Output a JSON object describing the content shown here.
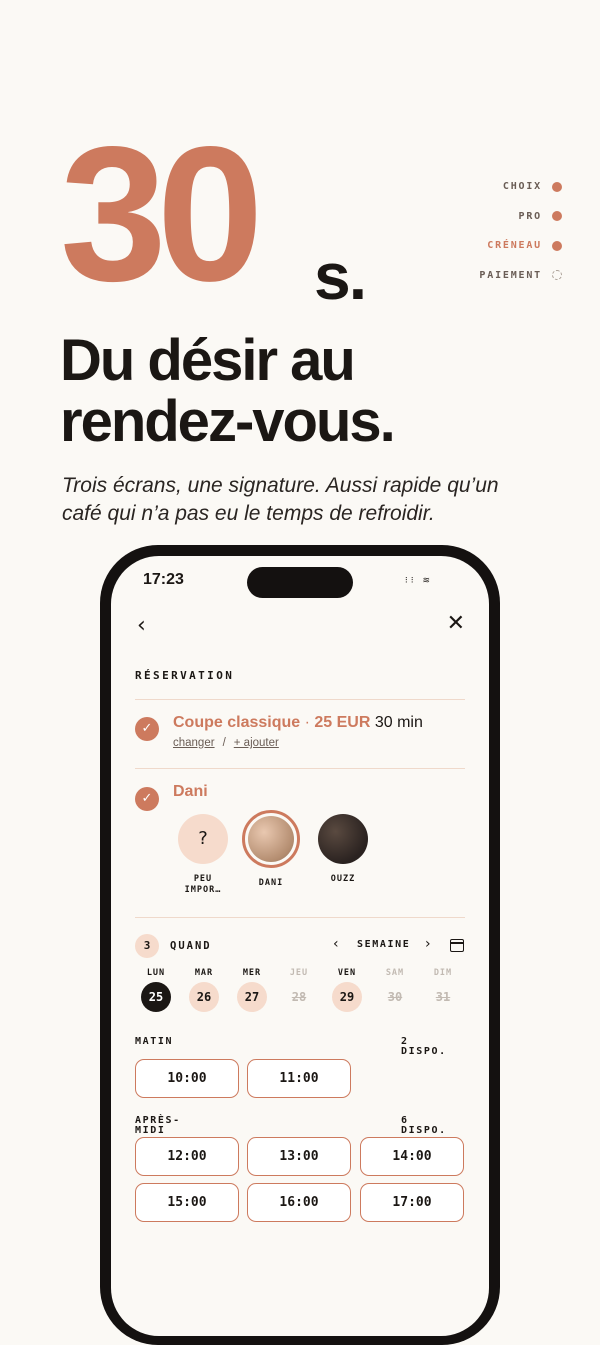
{
  "hero": {
    "number": "30",
    "unit": "s.",
    "headline_line1": "Du désir au",
    "headline_line2": "rendez-vous.",
    "subline": "Trois écrans, une signature. Aussi rapide qu’un café qui n’a pas eu le temps de refroidir."
  },
  "steps": [
    {
      "label": "CHOIX",
      "state": "done"
    },
    {
      "label": "PRO",
      "state": "done"
    },
    {
      "label": "CRÉNEAU",
      "state": "active"
    },
    {
      "label": "PAIEMENT",
      "state": "pending"
    }
  ],
  "phone": {
    "status_time": "17:23",
    "status_icons": "signal-icon wifi-icon"
  },
  "booking": {
    "title": "RÉSERVATION",
    "service": {
      "name": "Coupe classique",
      "separator": " · ",
      "price": "25 EUR",
      "duration": "30 min",
      "change_link": "changer",
      "link_separator": "/",
      "add_link": "+ ajouter"
    },
    "professional": {
      "selected_name": "Dani",
      "options": [
        {
          "label": "PEU IMPOR…",
          "line1": "PEU",
          "line2": "IMPOR…",
          "symbol": "?"
        },
        {
          "label": "DANI"
        },
        {
          "label": "OUZZ"
        }
      ]
    },
    "when": {
      "step_number": "3",
      "label": "QUAND",
      "week_label": "SEMAINE",
      "days": [
        {
          "name": "LUN",
          "num": "25",
          "state": "selected"
        },
        {
          "name": "MAR",
          "num": "26",
          "state": "available"
        },
        {
          "name": "MER",
          "num": "27",
          "state": "available"
        },
        {
          "name": "JEU",
          "num": "28",
          "state": "disabled"
        },
        {
          "name": "VEN",
          "num": "29",
          "state": "available"
        },
        {
          "name": "SAM",
          "num": "30",
          "state": "disabled"
        },
        {
          "name": "DIM",
          "num": "31",
          "state": "disabled"
        }
      ]
    },
    "periods": {
      "morning": {
        "line1": "MATIN",
        "count_line1": "2",
        "count_line2": "DISPO.",
        "slots": [
          "10:00",
          "11:00"
        ]
      },
      "afternoon": {
        "line1": "APRÈS-",
        "line2": "MIDI",
        "count_line1": "6",
        "count_line2": "DISPO.",
        "slots": [
          "12:00",
          "13:00",
          "14:00",
          "15:00",
          "16:00",
          "17:00"
        ]
      }
    }
  },
  "colors": {
    "accent": "#cd7a5e",
    "accent_soft": "#f6dbcc",
    "ink": "#1b1714",
    "background": "#fbf9f5"
  }
}
